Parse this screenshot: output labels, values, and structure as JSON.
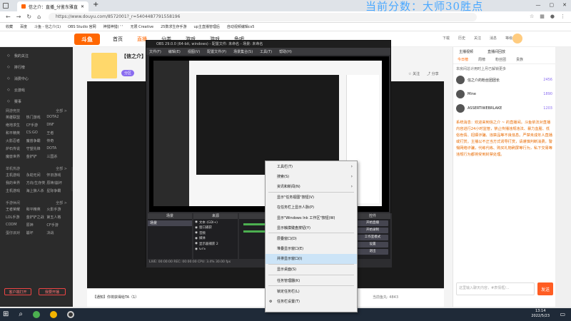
{
  "overlay": {
    "score_text": "当前分数：大师30胜点"
  },
  "browser": {
    "tab_title": "信之介：直播_分鉴东雅直播",
    "url": "https://www.douyu.com/8572001?_r=5404487791558196",
    "bookmarks": [
      "收藏",
      "百度",
      "斗鱼 - 信之介(1)",
      "OBS Studio 官网",
      "神猎神猎( ' '",
      "无限 Creative",
      "25数求生存手游",
      "up主直播管理后",
      "自动视频编辑cs5"
    ]
  },
  "site": {
    "nav": [
      "首页",
      "直播",
      "分类",
      "游戏",
      "游戏",
      "鱼吧"
    ],
    "header_right": [
      "下载",
      "历史",
      "关注",
      "消息",
      "等级"
    ]
  },
  "sidebar": {
    "items": [
      "我的关注",
      "排行榜",
      "消费中心",
      "云游戏",
      "赛事"
    ],
    "sections": [
      {
        "title": "网游竞技",
        "more": "全部 >",
        "games": [
          "英雄联盟",
          "热门游戏",
          "DOTA2",
          "绝地求生",
          "CF手游",
          "DNF",
          "和平精英",
          "CS:GO",
          "王者",
          "火影忍者",
          "魔兽争霸",
          "传奇",
          "炉石传说",
          "守望先锋",
          "DOTA",
          "魔兽世界",
          "金铲铲",
          "三国杀"
        ]
      },
      {
        "title": "单机热游",
        "more": "全部 >",
        "games": [
          "主机游戏",
          "永劫无间",
          "怀旧游戏",
          "我的世界",
          "方舟/生存类",
          "原神/崩坏",
          "主机游戏",
          "海上狼人杀",
          "星际争霸"
        ]
      },
      {
        "title": "手游休闲",
        "more": "全部 >",
        "games": [
          "王者荣耀",
          "和平精英",
          "火影手游",
          "LOL手游",
          "金铲铲之战",
          "第五人格",
          "CODM",
          "原神",
          "CF手游",
          "蛋仔派对",
          "崩坏",
          "决战"
        ]
      }
    ],
    "buttons": [
      "客户端打开",
      "我要开播"
    ]
  },
  "streamer": {
    "name": "信之介",
    "tag": "【信之介】",
    "badge": "分区"
  },
  "obs": {
    "title": "OBS 29.0.0 (64-bit, windows) - 配置文件: 未命名 - 场景: 未命名",
    "menu": [
      "文件(F)",
      "编辑(E)",
      "视图(V)",
      "配置文件(P)",
      "场景集合(S)",
      "工具(T)",
      "帮助(H)"
    ],
    "panels": [
      "场景",
      "来源",
      "混音器",
      "转场",
      "控件"
    ],
    "sources": [
      "文本 (GDI+)",
      "窗口捕获",
      "音频",
      "媒体",
      "显示器捕获 2",
      "GTS"
    ],
    "controls": [
      "开始直播",
      "开始录制",
      "工作室模式",
      "设置",
      "退出"
    ],
    "status": "LIVE: 00:00:00  REC: 00:00:00  CPU: 3.4%  30.00 fps"
  },
  "context_menu": {
    "items": [
      {
        "label": "工具栏(T)",
        "sub": true
      },
      {
        "label": "搜索(S)",
        "sub": true
      },
      {
        "label": "资讯和新闻(N)",
        "sub": true
      },
      {
        "label": "显示\"任务视图\"按钮(V)",
        "sub": false
      },
      {
        "label": "在任务栏上显示人脉(P)",
        "sub": false
      },
      {
        "label": "显示\"Windows Ink 工作区\"按钮(W)",
        "sub": false
      },
      {
        "label": "显示触摸键盘按钮(Y)",
        "sub": false
      },
      {
        "label": "层叠窗口(D)",
        "sub": false
      },
      {
        "label": "堆叠显示窗口(E)",
        "sub": false
      },
      {
        "label": "并排显示窗口(I)",
        "sub": false,
        "highlight": true
      },
      {
        "label": "显示桌面(S)",
        "sub": false
      },
      {
        "label": "任务管理器(K)",
        "sub": false
      },
      {
        "label": "锁定任务栏(L)",
        "sub": false
      },
      {
        "label": "任务栏设置(T)",
        "sub": false,
        "gear": true
      }
    ]
  },
  "chat": {
    "tabs": [
      "主播视频",
      "直播间回放"
    ],
    "subtabs": [
      "今日榜",
      "周榜",
      "粉丝团",
      "贵族"
    ],
    "notice": "本房间总计用时上月已解锁更多",
    "ranks": [
      {
        "name": "信之介的粉丝团团长",
        "score": "2456"
      },
      {
        "name": "Mine",
        "score": "1890"
      },
      {
        "name": "ASSERTIWEBRLAKE",
        "score": "1203"
      }
    ],
    "system_msg": "系统消息：欢迎来到信之介 ~ 的直播间。斗鱼依法对直播内容进行24小时监管，禁止传播违规违法、暴力血腥、低俗色情、招嫖诈骗、违禁品等不良信息。严禁未成年人直播或打赏。主播以不正当方式诱导打赏，请谨慎判断消费，警惕网络诈骗，代练代练、购买礼物刷屏等行为，私下交易等违规行为都将受到封禁处理。",
    "input_placeholder": "这里输入聊天内容，#表情框/...",
    "send_label": "发送"
  },
  "player": {
    "footer_text": "【通知】你将获得给TA（1）",
    "gift_count": "当前鱼丸: 4843"
  },
  "taskbar": {
    "time": "13:14",
    "date": "2022/5/23"
  }
}
